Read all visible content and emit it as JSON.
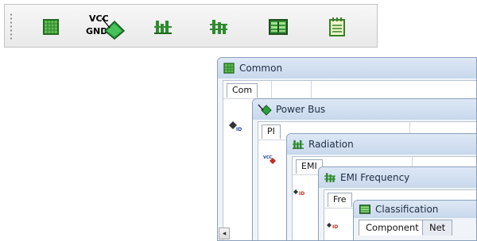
{
  "toolbar": {
    "buttons": [
      {
        "icon": "grid-chip-icon"
      },
      {
        "icon": "power-bus-icon",
        "text_top": "VCC",
        "text_bottom": "GND"
      },
      {
        "icon": "radiation-icon"
      },
      {
        "icon": "emi-frequency-icon"
      },
      {
        "icon": "classification-icon"
      },
      {
        "icon": "notepad-icon"
      }
    ]
  },
  "windows": {
    "common": {
      "title": "Common",
      "tab": "Com"
    },
    "power_bus": {
      "title": "Power Bus",
      "tab": "PI"
    },
    "radiation": {
      "title": "Radiation",
      "tab": "EMI"
    },
    "emi_frequency": {
      "title": "EMI Frequency",
      "tab": "Fre"
    },
    "classification": {
      "title": "Classification",
      "tabs": [
        "Component",
        "Net"
      ]
    }
  },
  "row_icon_labels": [
    "ID",
    "VCC",
    "ID"
  ],
  "scroll_left": "◂",
  "colors": {
    "accent_green": "#2e8b2e",
    "title_bar": "#c8d8ec",
    "window_border": "#8aa0bb"
  }
}
